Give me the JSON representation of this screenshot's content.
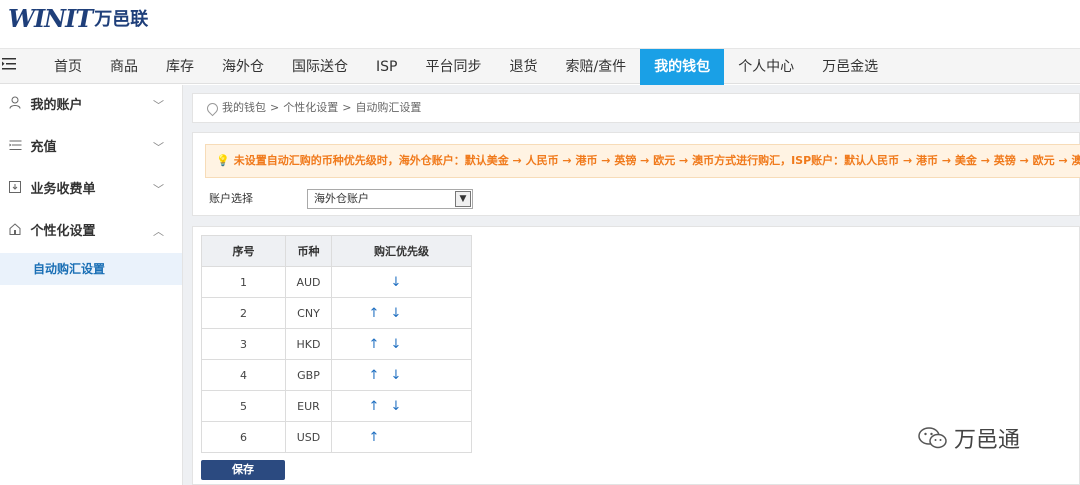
{
  "brand": {
    "logo_mark": "WINIT",
    "logo_cn": "万邑联"
  },
  "nav": {
    "items": [
      {
        "label": "首页"
      },
      {
        "label": "商品"
      },
      {
        "label": "库存"
      },
      {
        "label": "海外仓"
      },
      {
        "label": "国际送仓"
      },
      {
        "label": "ISP"
      },
      {
        "label": "平台同步"
      },
      {
        "label": "退货"
      },
      {
        "label": "索赔/查件"
      },
      {
        "label": "我的钱包",
        "active": true
      },
      {
        "label": "个人中心"
      },
      {
        "label": "万邑金选"
      }
    ]
  },
  "sidebar": {
    "groups": [
      {
        "label": "我的账户",
        "icon": "user-icon",
        "expanded": false
      },
      {
        "label": "充值",
        "icon": "recharge-icon",
        "expanded": false
      },
      {
        "label": "业务收费单",
        "icon": "bill-icon",
        "expanded": false
      },
      {
        "label": "个性化设置",
        "icon": "home-settings-icon",
        "expanded": true
      }
    ],
    "active_sub": "自动购汇设置"
  },
  "breadcrumb": {
    "items": [
      "我的钱包",
      "个性化设置",
      "自动购汇设置"
    ],
    "separator": ">"
  },
  "notice": {
    "text": "未设置自动汇购的币种优先级时，海外仓账户：默认美金 → 人民币 → 港币 → 英镑 → 欧元 → 澳币方式进行购汇，ISP账户：默认人民币 → 港币 → 美金 → 英镑 → 欧元 → 澳币方式进行购汇"
  },
  "account": {
    "label": "账户选择",
    "selected": "海外仓账户"
  },
  "table": {
    "headers": {
      "seq": "序号",
      "currency": "币种",
      "priority": "购汇优先级"
    },
    "rows": [
      {
        "seq": "1",
        "currency": "AUD",
        "up": false,
        "down": true
      },
      {
        "seq": "2",
        "currency": "CNY",
        "up": true,
        "down": true
      },
      {
        "seq": "3",
        "currency": "HKD",
        "up": true,
        "down": true
      },
      {
        "seq": "4",
        "currency": "GBP",
        "up": true,
        "down": true
      },
      {
        "seq": "5",
        "currency": "EUR",
        "up": true,
        "down": true
      },
      {
        "seq": "6",
        "currency": "USD",
        "up": true,
        "down": false
      }
    ],
    "up_glyph": "↑",
    "down_glyph": "↓"
  },
  "actions": {
    "save_label": "保存"
  },
  "watermark": {
    "text": "万邑通"
  },
  "colors": {
    "nav_active": "#1aa0e6",
    "brand": "#1f3f7a",
    "notice_text": "#f07a1c",
    "save_button": "#2b4a80",
    "sidebar_active": "#1a6fb5"
  }
}
